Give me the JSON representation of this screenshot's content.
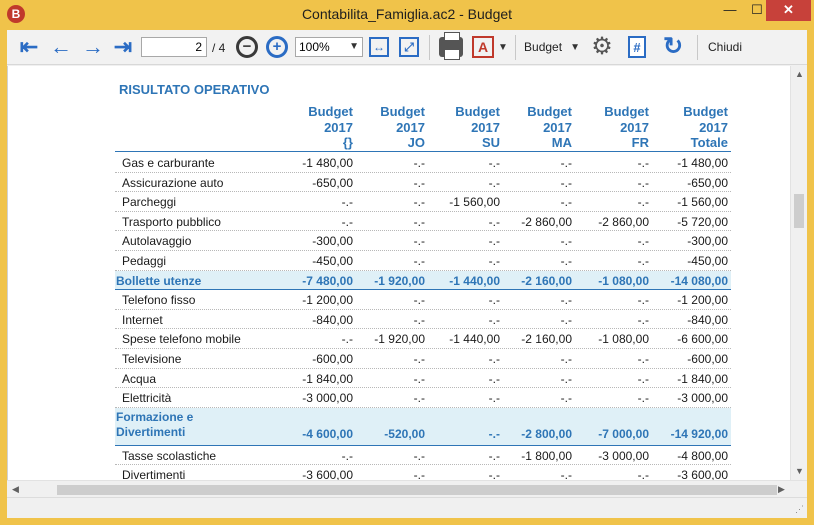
{
  "window": {
    "title": "Contabilita_Famiglia.ac2 - Budget",
    "app_icon_letter": "B",
    "minimize_glyph": "—",
    "maximize_glyph": "☐",
    "close_glyph": "✕"
  },
  "toolbar": {
    "first_page_glyph": "⇤",
    "prev_page_glyph": "←",
    "next_page_glyph": "→",
    "last_page_glyph": "⇥",
    "page_value": "2",
    "page_total": "/ 4",
    "zoom_out_glyph": "−",
    "zoom_in_glyph": "+",
    "zoom_value": "100%",
    "fit_width_glyph": "↔",
    "fit_page_glyph": "⤢",
    "pdf_glyph": "A",
    "budget_label": "Budget",
    "gear_glyph": "⚙",
    "doc_glyph": "#",
    "refresh_glyph": "↻",
    "close_label": "Chiudi",
    "icons": [
      "first-page-icon",
      "prev-page-icon",
      "next-page-icon",
      "last-page-icon",
      "zoom-out-icon",
      "zoom-in-icon",
      "fit-width-icon",
      "fit-page-icon",
      "print-icon",
      "pdf-icon",
      "gear-icon",
      "document-icon",
      "refresh-icon"
    ]
  },
  "report": {
    "title": "RISULTATO OPERATIVO",
    "columns": [
      {
        "line1": "Budget",
        "line2": "2017",
        "line3": "{}"
      },
      {
        "line1": "Budget",
        "line2": "2017",
        "line3": "JO"
      },
      {
        "line1": "Budget",
        "line2": "2017",
        "line3": "SU"
      },
      {
        "line1": "Budget",
        "line2": "2017",
        "line3": "MA"
      },
      {
        "line1": "Budget",
        "line2": "2017",
        "line3": "FR"
      },
      {
        "line1": "Budget",
        "line2": "2017",
        "line3": "Totale"
      }
    ],
    "rows": [
      {
        "label": "Gas e carburante",
        "values": [
          "-1 480,00",
          "-.-",
          "-.-",
          "-.-",
          "-.-",
          "-1 480,00"
        ]
      },
      {
        "label": "Assicurazione auto",
        "values": [
          "-650,00",
          "-.-",
          "-.-",
          "-.-",
          "-.-",
          "-650,00"
        ]
      },
      {
        "label": "Parcheggi",
        "values": [
          "-.-",
          "-.-",
          "-1 560,00",
          "-.-",
          "-.-",
          "-1 560,00"
        ]
      },
      {
        "label": "Trasporto pubblico",
        "values": [
          "-.-",
          "-.-",
          "-.-",
          "-2 860,00",
          "-2 860,00",
          "-5 720,00"
        ]
      },
      {
        "label": "Autolavaggio",
        "values": [
          "-300,00",
          "-.-",
          "-.-",
          "-.-",
          "-.-",
          "-300,00"
        ]
      },
      {
        "label": "Pedaggi",
        "values": [
          "-450,00",
          "-.-",
          "-.-",
          "-.-",
          "-.-",
          "-450,00"
        ]
      },
      {
        "label": "Bollette utenze",
        "values": [
          "-7 480,00",
          "-1 920,00",
          "-1 440,00",
          "-2 160,00",
          "-1 080,00",
          "-14 080,00"
        ],
        "group": true
      },
      {
        "label": "Telefono fisso",
        "values": [
          "-1 200,00",
          "-.-",
          "-.-",
          "-.-",
          "-.-",
          "-1 200,00"
        ]
      },
      {
        "label": "Internet",
        "values": [
          "-840,00",
          "-.-",
          "-.-",
          "-.-",
          "-.-",
          "-840,00"
        ]
      },
      {
        "label": "Spese telefono mobile",
        "values": [
          "-.-",
          "-1 920,00",
          "-1 440,00",
          "-2 160,00",
          "-1 080,00",
          "-6 600,00"
        ]
      },
      {
        "label": "Televisione",
        "values": [
          "-600,00",
          "-.-",
          "-.-",
          "-.-",
          "-.-",
          "-600,00"
        ]
      },
      {
        "label": "Acqua",
        "values": [
          "-1 840,00",
          "-.-",
          "-.-",
          "-.-",
          "-.-",
          "-1 840,00"
        ]
      },
      {
        "label": "Elettricità",
        "values": [
          "-3 000,00",
          "-.-",
          "-.-",
          "-.-",
          "-.-",
          "-3 000,00"
        ]
      },
      {
        "label": "Formazione e",
        "label2": "Divertimenti",
        "values": [
          "-4 600,00",
          "-520,00",
          "-.-",
          "-2 800,00",
          "-7 000,00",
          "-14 920,00"
        ],
        "group": true,
        "tall": true
      },
      {
        "label": "Tasse scolastiche",
        "values": [
          "-.-",
          "-.-",
          "-.-",
          "-1 800,00",
          "-3 000,00",
          "-4 800,00"
        ]
      },
      {
        "label": "Divertimenti",
        "values": [
          "-3 600,00",
          "-.-",
          "-.-",
          "-.-",
          "-.-",
          "-3 600,00"
        ]
      }
    ]
  }
}
